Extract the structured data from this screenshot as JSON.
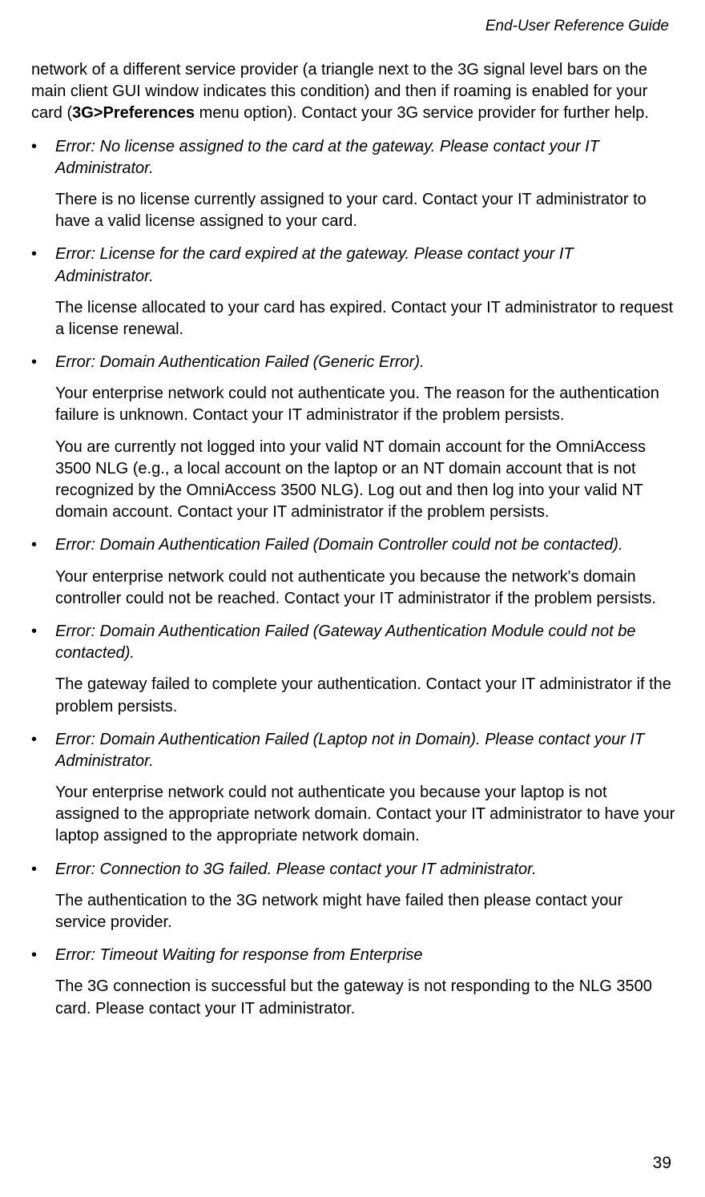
{
  "header": {
    "title": "End-User Reference Guide"
  },
  "intro": {
    "segments": [
      {
        "text": "network of a different service provider (a triangle next to the 3G signal level bars on the main client GUI window indicates this condition) and then if roaming is enabled for your card (",
        "bold": false
      },
      {
        "text": "3G>Preferences",
        "bold": true
      },
      {
        "text": " menu option). Contact your 3G service provider for further help.",
        "bold": false
      }
    ]
  },
  "errors": [
    {
      "title": "Error: No license assigned to the card at the gateway. Please contact your IT Administrator.",
      "paragraphs": [
        "There is no license currently assigned to your card. Contact your IT administrator to have a valid license assigned to your card."
      ]
    },
    {
      "title": "Error: License for the card expired at the gateway.  Please contact your IT Administrator.",
      "paragraphs": [
        "The license allocated to your card has expired. Contact your IT administrator to request a license renewal."
      ]
    },
    {
      "title": "Error: Domain Authentication Failed (Generic Error).",
      "paragraphs": [
        "Your enterprise network could not authenticate you. The reason for the authentication failure is unknown. Contact your IT administrator if the problem persists.",
        "You are currently not logged into your valid NT domain account for the OmniAccess 3500 NLG (e.g., a local account on the laptop or an NT domain account that is not recognized by the OmniAccess 3500 NLG). Log out and then log into your valid NT domain account. Contact your IT administrator if the problem persists."
      ]
    },
    {
      "title": "Error: Domain Authentication Failed (Domain Controller could not be contacted).",
      "paragraphs": [
        "Your enterprise network could not authenticate you because the network's domain controller could not be reached. Contact your IT administrator if the problem persists."
      ]
    },
    {
      "title": "Error: Domain Authentication Failed (Gateway Authentication Module could not be contacted).",
      "paragraphs": [
        "The gateway failed to complete your authentication. Contact your IT administrator if the problem persists."
      ]
    },
    {
      "title": "Error: Domain Authentication Failed (Laptop not in Domain). Please contact your IT Administrator.",
      "paragraphs": [
        "Your enterprise network could not authenticate you because your laptop is not assigned to the appropriate network domain. Contact your IT administrator to have your laptop assigned to the appropriate network domain."
      ]
    },
    {
      "title": "Error: Connection to 3G failed. Please contact your IT administrator.",
      "paragraphs": [
        "The authentication to the 3G network might have failed then please contact your service provider."
      ]
    },
    {
      "title": "Error: Timeout Waiting for response from Enterprise",
      "paragraphs": [
        "The 3G connection is successful but the gateway is not responding to the NLG 3500 card. Please contact your IT administrator."
      ]
    }
  ],
  "page_number": "39"
}
